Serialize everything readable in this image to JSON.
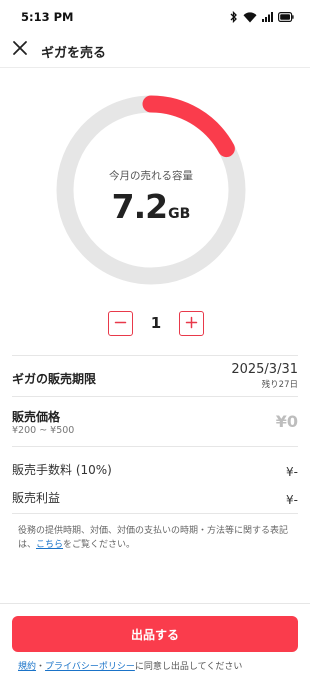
{
  "status_bar": {
    "time": "5:13 PM",
    "icons": [
      "bluetooth-icon",
      "wifi-icon",
      "signal-icon",
      "battery-icon"
    ]
  },
  "header": {
    "title": "ギガを売る",
    "close_icon": "close-icon"
  },
  "gauge": {
    "label": "今月の売れる容量",
    "value": "7.2",
    "unit": "GB",
    "fill_fraction": 0.17,
    "track_color": "#e6e6e6",
    "fill_color": "#fa3c4c"
  },
  "stepper": {
    "minus_icon": "minus-icon",
    "plus_icon": "plus-icon",
    "value": "1"
  },
  "deadline": {
    "label": "ギガの販売期限",
    "date": "2025/3/31",
    "remaining": "残り27日"
  },
  "price": {
    "label": "販売価格",
    "range": "¥200 ~ ¥500",
    "amount": "¥0"
  },
  "fee": {
    "label": "販売手数料 (10%)",
    "value": "¥-"
  },
  "profit": {
    "label": "販売利益",
    "value": "¥-"
  },
  "notice": {
    "text_before": "役務の提供時期、対価、対価の支払いの時期・方法等に関する表記は、",
    "link": "こちら",
    "text_after": "をご覧ください。"
  },
  "submit": {
    "label": "出品する"
  },
  "terms": {
    "link_terms": "規約",
    "separator": "・",
    "link_privacy": "プライバシーポリシー",
    "text": "に同意し出品してください"
  },
  "colors": {
    "accent": "#fa3c4c",
    "link": "#1a73c8"
  }
}
